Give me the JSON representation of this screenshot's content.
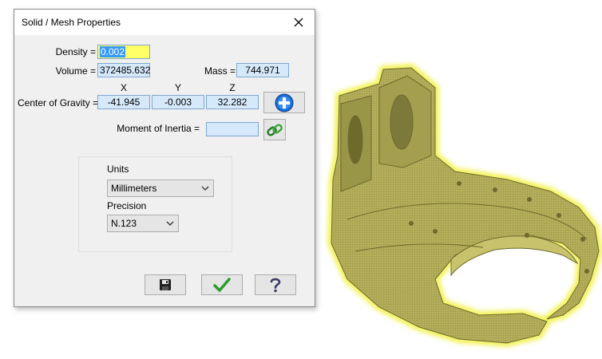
{
  "dialog": {
    "title": "Solid / Mesh Properties",
    "close_icon": "close-icon",
    "density_label": "Density =",
    "density_value": "0.002",
    "volume_label": "Volume =",
    "volume_value": "372485.632",
    "mass_label": "Mass =",
    "mass_value": "744.971",
    "axes": {
      "x": "X",
      "y": "Y",
      "z": "Z"
    },
    "cog_label": "Center of Gravity =",
    "cog": {
      "x": "-41.945",
      "y": "-0.003",
      "z": "32.282"
    },
    "cog_button_icon": "plus-circle-icon",
    "moment_label": "Moment of Inertia =",
    "moment_value": "",
    "moment_button_icon": "chain-link-icon",
    "units_label": "Units",
    "units_selected": "Millimeters",
    "precision_label": "Precision",
    "precision_selected": "N.123",
    "buttons": {
      "save_icon": "floppy-disk-icon",
      "ok_icon": "check-icon",
      "help_icon": "question-icon"
    }
  },
  "colors": {
    "field_bg": "#d6e9fb",
    "field_border": "#7fa7cf",
    "selected_field_bg": "#ffff66",
    "text_selection": "#3399ff",
    "model_fill": "#b6b15c",
    "model_glow": "#f3f35c",
    "ok_green": "#2a9d2a"
  }
}
